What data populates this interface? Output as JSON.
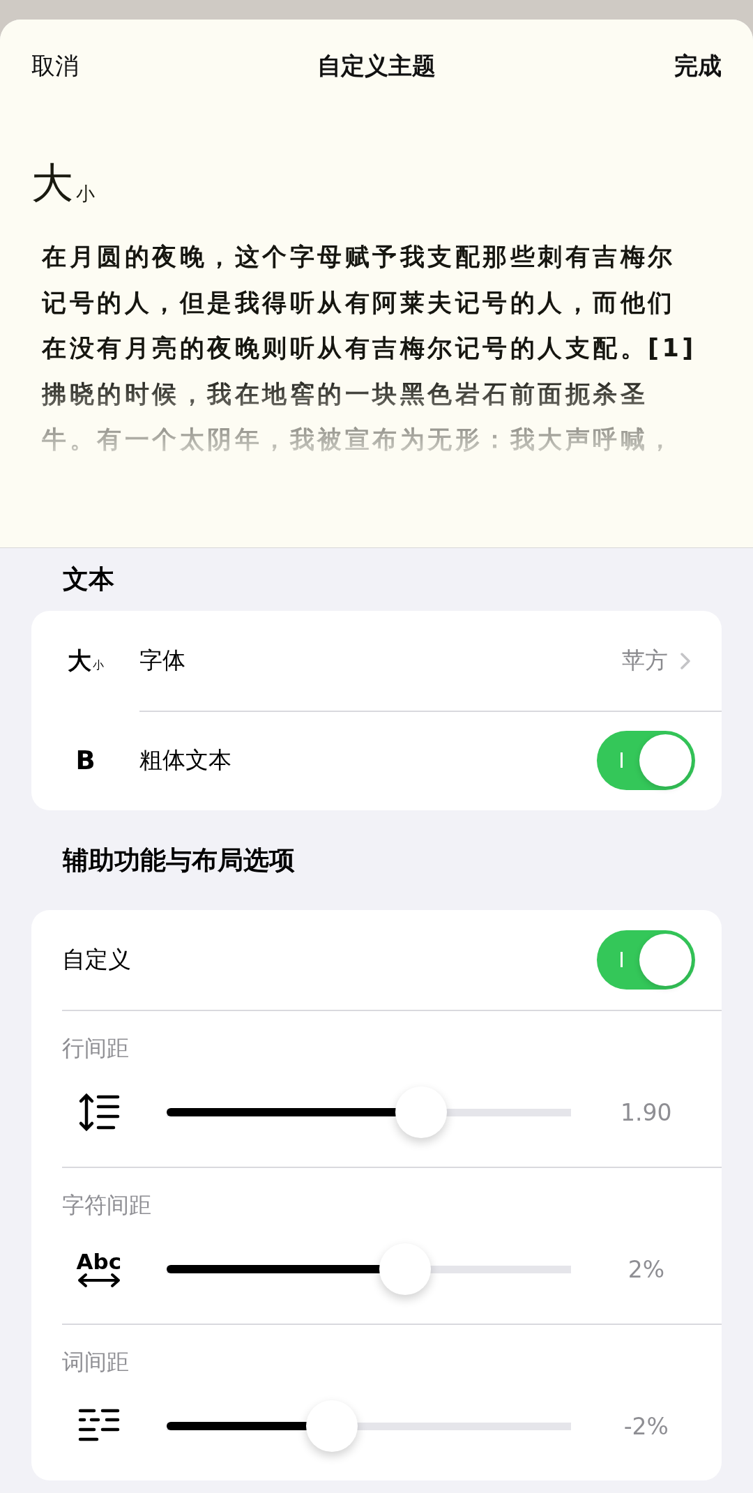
{
  "nav": {
    "cancel": "取消",
    "title": "自定义主题",
    "done": "完成"
  },
  "preview": {
    "big": "大",
    "small": "小",
    "lines": [
      "在月圆的夜晚，这个字母赋予我支配那些刺有吉梅尔",
      "记号的人，但是我得听从有阿莱夫记号的人，而他们",
      "在没有月亮的夜晚则听从有吉梅尔记号的人支配。[1]",
      "拂晓的时候，我在地窖的一块黑色岩石前面扼杀圣",
      "牛。有一个太阴年，我被宣布为无形：我大声呼喊，"
    ]
  },
  "sections": [
    {
      "title": "文本",
      "rows": [
        {
          "kind": "link",
          "glyph": "大",
          "glyph_small": "小",
          "label": "字体",
          "value": "苹方"
        },
        {
          "kind": "toggle",
          "glyph": "B",
          "label": "粗体文本",
          "on": true
        }
      ]
    },
    {
      "title": "辅助功能与布局选项",
      "rows": [
        {
          "kind": "toggle",
          "label": "自定义",
          "on": true
        },
        {
          "kind": "slider",
          "label": "行间距",
          "level": 0.63,
          "reading": "1.90"
        },
        {
          "kind": "slider",
          "glyph": "Abc",
          "label": "字符间距",
          "level": 0.59,
          "reading": "2%"
        },
        {
          "kind": "slider",
          "label": "词间距",
          "level": 0.41,
          "reading": "-2%"
        }
      ]
    }
  ]
}
